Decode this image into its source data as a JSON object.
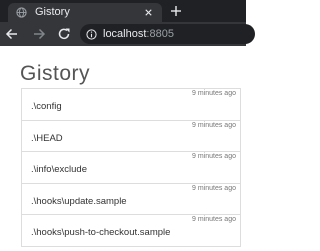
{
  "browser": {
    "tab": {
      "title": "Gistory"
    },
    "new_tab_symbol": "+",
    "address": {
      "host": "localhost",
      "port": ":8805"
    }
  },
  "page": {
    "title": "Gistory",
    "files": [
      {
        "path": ".\\config",
        "time": "9 minutes ago"
      },
      {
        "path": ".\\HEAD",
        "time": "9 minutes ago"
      },
      {
        "path": ".\\info\\exclude",
        "time": "9 minutes ago"
      },
      {
        "path": ".\\hooks\\update.sample",
        "time": "9 minutes ago"
      },
      {
        "path": ".\\hooks\\push-to-checkout.sample",
        "time": "9 minutes ago"
      }
    ]
  },
  "colors": {
    "tabstrip": "#202124",
    "toolbar": "#35363a",
    "page_background": "#ffffff",
    "row_border": "#dddddd"
  },
  "icons": [
    "globe-icon",
    "close-icon",
    "plus-icon",
    "back-arrow-icon",
    "forward-arrow-icon",
    "reload-icon",
    "info-icon"
  ]
}
